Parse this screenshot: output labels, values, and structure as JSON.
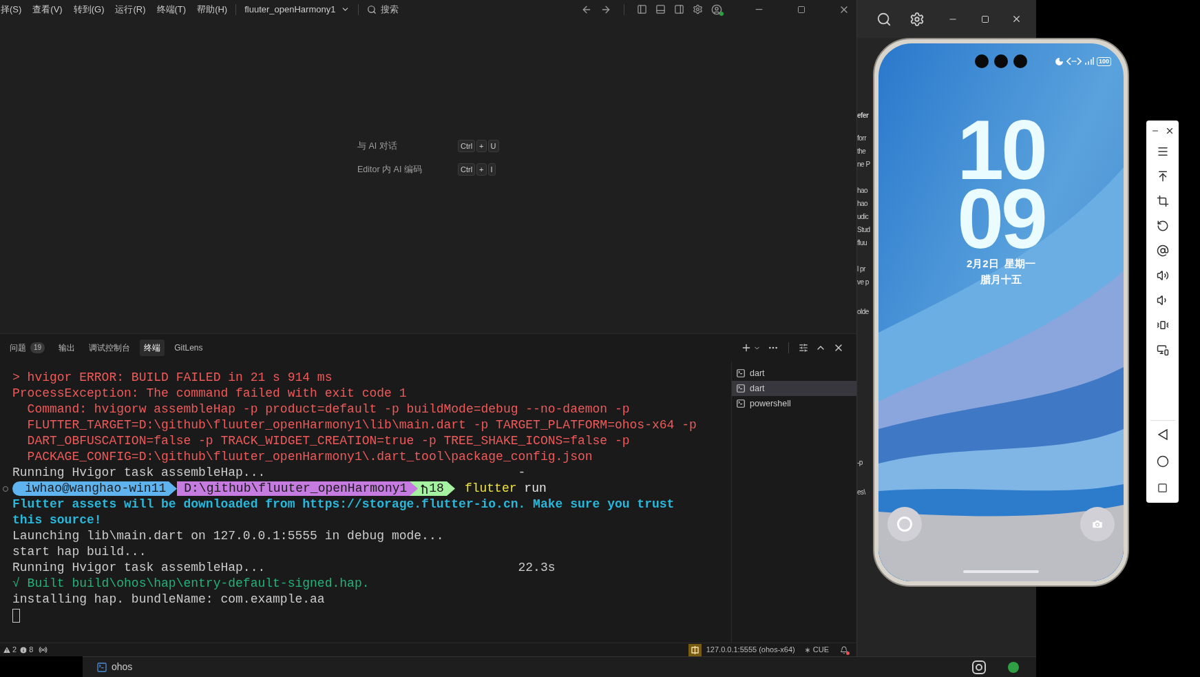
{
  "menu": [
    "择(S)",
    "查看(V)",
    "转到(G)",
    "运行(R)",
    "终端(T)",
    "帮助(H)"
  ],
  "project": "fluuter_openHarmony1",
  "search": {
    "placeholder": "搜索"
  },
  "shortcuts": [
    {
      "label": "与 AI 对话",
      "keys": [
        "Ctrl",
        "+",
        "U"
      ]
    },
    {
      "label": "Editor 内 AI 编码",
      "keys": [
        "Ctrl",
        "+",
        "I"
      ]
    }
  ],
  "panel_tabs": [
    {
      "label": "问题",
      "badge": "19",
      "selected": false
    },
    {
      "label": "输出",
      "selected": false
    },
    {
      "label": "调试控制台",
      "selected": false
    },
    {
      "label": "终端",
      "selected": true
    },
    {
      "label": "GitLens",
      "selected": false
    }
  ],
  "terminal_lines": [
    {
      "kind": "error",
      "text": "> hvigor ERROR: BUILD FAILED in 21 s 914 ms"
    },
    {
      "kind": "error",
      "text": "ProcessException: The command failed with exit code 1"
    },
    {
      "kind": "error",
      "text": "  Command: hvigorw assembleHap -p product=default -p buildMode=debug --no-daemon -p"
    },
    {
      "kind": "error",
      "text": "  FLUTTER_TARGET=D:\\github\\fluuter_openHarmony1\\lib\\main.dart -p TARGET_PLATFORM=ohos-x64 -p"
    },
    {
      "kind": "error",
      "text": "  DART_OBFUSCATION=false -p TRACK_WIDGET_CREATION=true -p TREE_SHAKE_ICONS=false -p"
    },
    {
      "kind": "error",
      "text": "  PACKAGE_CONFIG=D:\\github\\fluuter_openHarmony1\\.dart_tool\\package_config.json"
    },
    {
      "kind": "plain",
      "text": "Running Hvigor task assembleHap...",
      "suffix": "-"
    },
    {
      "kind": "prompt",
      "user": "iwhao@wanghao-win11",
      "path": "D:\\github\\fluuter_openHarmony1",
      "branch": "18",
      "command": "flutter",
      "args": "run"
    },
    {
      "kind": "info",
      "text": "Flutter assets will be downloaded from https://storage.flutter-io.cn. Make sure you trust this source!"
    },
    {
      "kind": "plain",
      "text": "Launching lib\\main.dart on 127.0.0.1:5555 in debug mode..."
    },
    {
      "kind": "plain",
      "text": "start hap build..."
    },
    {
      "kind": "plain",
      "text": "Running Hvigor task assembleHap...",
      "suffix": "22.3s"
    },
    {
      "kind": "success",
      "text": "√ Built build\\ohos\\hap\\entry-default-signed.hap."
    },
    {
      "kind": "plain",
      "text": "installing hap. bundleName: com.example.aa"
    },
    {
      "kind": "cursor"
    }
  ],
  "terminals": [
    {
      "name": "dart",
      "selected": false
    },
    {
      "name": "dart",
      "selected": true
    },
    {
      "name": "powershell",
      "selected": false
    }
  ],
  "status_bar": {
    "warnings": "2",
    "infos": "8",
    "device": "127.0.0.1:5555 (ohos-x64)",
    "language": "CUE"
  },
  "behind_window_text": [
    "efer",
    "forr",
    "the",
    "ne P",
    "hao",
    "hao",
    "udic",
    "Stud",
    "fluu",
    "l pr",
    "ve p",
    "olde",
    "-p",
    "es\\"
  ],
  "phone": {
    "hours": "10",
    "minutes": "09",
    "date": "2月2日  星期一",
    "lunar": "腊月十五",
    "battery": "100"
  },
  "taskbar": {
    "label": "ohos"
  }
}
